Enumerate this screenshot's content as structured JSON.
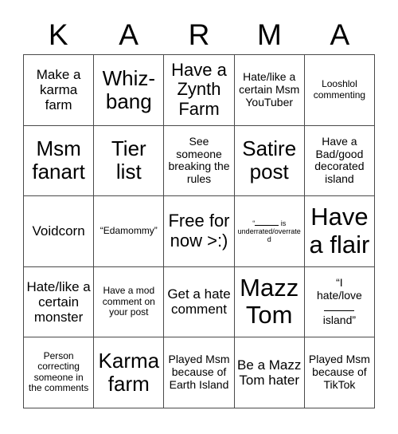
{
  "card": {
    "title_letters": [
      "K",
      "A",
      "R",
      "M",
      "A"
    ],
    "rows": [
      [
        {
          "text": "Make a karma farm",
          "size": "md"
        },
        {
          "text": "Whiz-bang",
          "size": "xl"
        },
        {
          "text": "Have a Zynth Farm",
          "size": "lg"
        },
        {
          "text": "Hate/like a certain Msm YouTuber",
          "size": "sm"
        },
        {
          "text": "Looshlol commenting",
          "size": "xs"
        }
      ],
      [
        {
          "text": "Msm fanart",
          "size": "xl"
        },
        {
          "text": "Tier list",
          "size": "xl"
        },
        {
          "text": "See someone breaking the rules",
          "size": "sm"
        },
        {
          "text": "Satire post",
          "size": "xl"
        },
        {
          "text": "Have a Bad/good decorated island",
          "size": "sm"
        }
      ],
      [
        {
          "text": "Voidcorn",
          "size": "md"
        },
        {
          "text": "“Edamommy”",
          "size": "xs"
        },
        {
          "text": "Free for now >:)",
          "size": "lg"
        },
        {
          "text": "“____ is underrated/overrated",
          "size": "xxs",
          "special": "underrated-blank"
        },
        {
          "text": "Have a flair",
          "size": "xxl"
        }
      ],
      [
        {
          "text": "Hate/like a certain monster",
          "size": "md"
        },
        {
          "text": "Have a mod comment on your post",
          "size": "xs"
        },
        {
          "text": "Get a hate comment",
          "size": "md"
        },
        {
          "text": "Mazz Tom",
          "size": "xxl"
        },
        {
          "text": "“I hate/love ____ island”",
          "size": "sm",
          "special": "island-blank"
        }
      ],
      [
        {
          "text": "Person correcting someone in the comments",
          "size": "xs"
        },
        {
          "text": "Karma farm",
          "size": "xl"
        },
        {
          "text": "Played Msm because of Earth Island",
          "size": "sm"
        },
        {
          "text": "Be a Mazz Tom hater",
          "size": "md"
        },
        {
          "text": "Played Msm because of TikTok",
          "size": "sm"
        }
      ]
    ]
  },
  "colors": {
    "background": "#ffffff",
    "text": "#000000",
    "grid_line": "#4a4a4a"
  }
}
